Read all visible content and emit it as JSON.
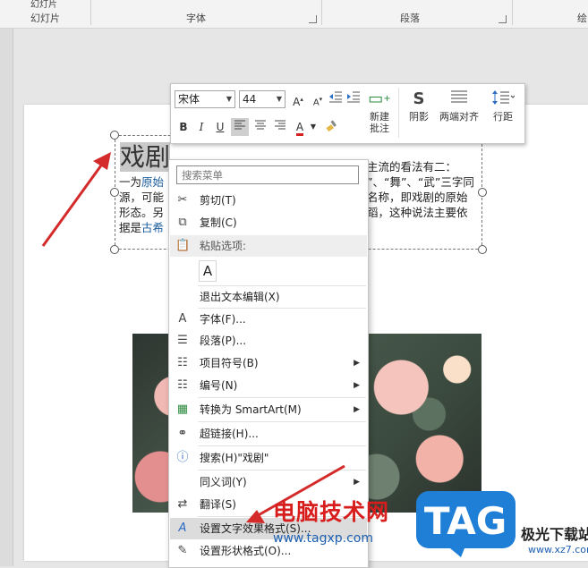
{
  "ribbon": {
    "groups": [
      "幻灯片",
      "字体",
      "段落",
      "绘"
    ],
    "top_fragment": "幻灯片"
  },
  "slide": {
    "title_text": "戏剧",
    "body_left": "一为原始源，可能形态。另据是古希",
    "body_left_parts": {
      "line1a": "一为",
      "line1b": "原始",
      "line2": "源，可能",
      "line3": "形态。另",
      "line4a": "据是",
      "line4b": "古希"
    },
    "body_right_lines": [
      "主流的看法有二：",
      "”、“舞”、“武”三字同",
      "名称，即戏剧的原始",
      "蹈，这种说法主要依"
    ]
  },
  "mini_toolbar": {
    "font_name": "宋体",
    "font_size": "44",
    "new_comment_label_1": "新建",
    "new_comment_label_2": "批注",
    "shadow_label": "阴影",
    "justify_label": "两端对齐",
    "line_spacing_label": "行距",
    "grow_font": "A",
    "shrink_font": "A",
    "bold": "B",
    "italic": "I",
    "underline": "U",
    "font_color_glyph": "A"
  },
  "context_menu": {
    "search_placeholder": "搜索菜单",
    "items": [
      {
        "label": "剪切(T)",
        "icon": "scissors-icon",
        "has_sub": false
      },
      {
        "label": "复制(C)",
        "icon": "copy-icon",
        "has_sub": false
      },
      {
        "label": "粘贴选项:",
        "icon": "paste-icon",
        "has_sub": false
      },
      {
        "label": "退出文本编辑(X)",
        "icon": "",
        "has_sub": false
      },
      {
        "label": "字体(F)...",
        "icon": "font-icon",
        "has_sub": false
      },
      {
        "label": "段落(P)...",
        "icon": "paragraph-icon",
        "has_sub": false
      },
      {
        "label": "项目符号(B)",
        "icon": "bullets-icon",
        "has_sub": true
      },
      {
        "label": "编号(N)",
        "icon": "numbering-icon",
        "has_sub": true
      },
      {
        "label": "转换为 SmartArt(M)",
        "icon": "smartart-icon",
        "has_sub": true
      },
      {
        "label": "超链接(H)...",
        "icon": "hyperlink-icon",
        "has_sub": false
      },
      {
        "label": "搜索(H)\"戏剧\"",
        "icon": "search-icon",
        "has_sub": false
      },
      {
        "label": "同义词(Y)",
        "icon": "",
        "has_sub": true
      },
      {
        "label": "翻译(S)",
        "icon": "translate-icon",
        "has_sub": false
      },
      {
        "label": "设置文字效果格式(S)...",
        "icon": "text-effects-icon",
        "has_sub": false
      },
      {
        "label": "设置形状格式(O)...",
        "icon": "shape-format-icon",
        "has_sub": false
      }
    ],
    "paste_glyph": "A"
  },
  "watermark": {
    "site_text": "电脑技术网",
    "site_url": "www.tagxp.com",
    "logo_text": "TAG",
    "right_site": "极光下载站",
    "right_url": "www.xz7.com"
  },
  "colors": {
    "arrow": "#d42a2a",
    "link": "#1a5c9c",
    "logo_blue": "#1f7fd6"
  }
}
